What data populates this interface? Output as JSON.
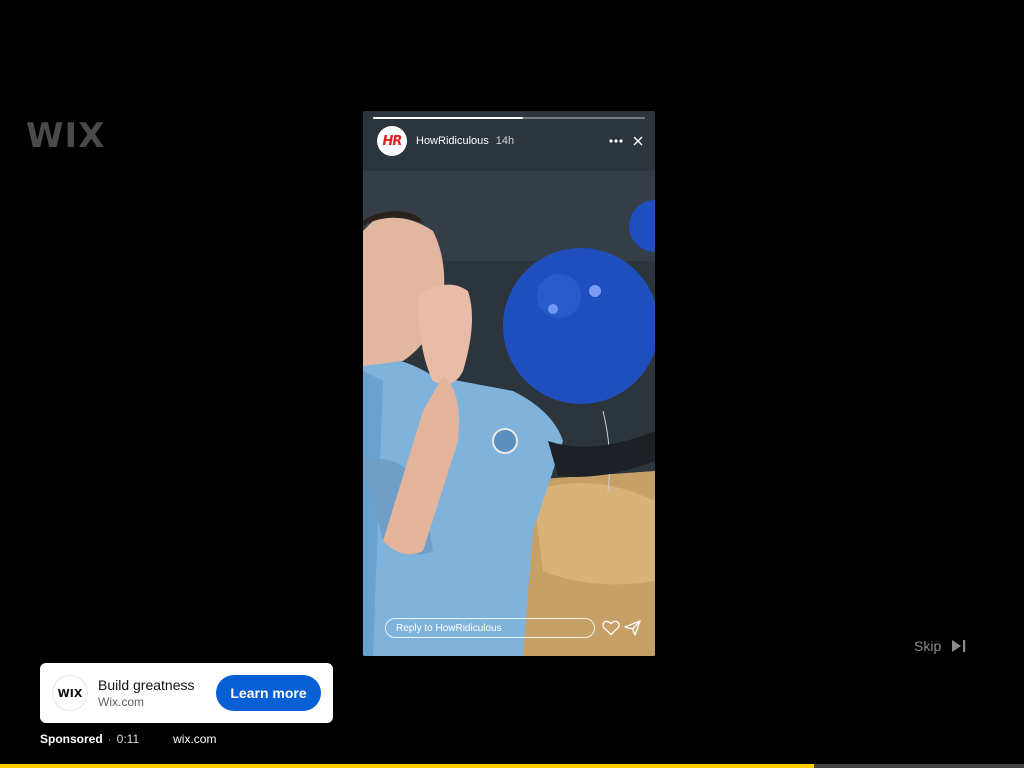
{
  "background_logo": "WIX",
  "story": {
    "avatar_text": "HR",
    "username": "HowRidiculous",
    "time": "14h",
    "progress_fraction": 0.55,
    "reply_placeholder": "Reply to HowRidiculous",
    "icons": {
      "more": "more-horizontal-icon",
      "close": "close-icon",
      "like": "heart-icon",
      "share": "send-icon"
    }
  },
  "skip": {
    "label": "Skip",
    "icon": "skip-next-icon"
  },
  "ad": {
    "logo_text": "WIX",
    "title": "Build greatness",
    "domain": "Wix.com",
    "cta_label": "Learn more",
    "sponsored_label": "Sponsored",
    "separator": "·",
    "time": "0:11",
    "url": "wix.com",
    "progress_fraction": 0.795
  },
  "colors": {
    "cta": "#065fd4",
    "ad_progress": "#ffcc00",
    "background": "#000000"
  }
}
